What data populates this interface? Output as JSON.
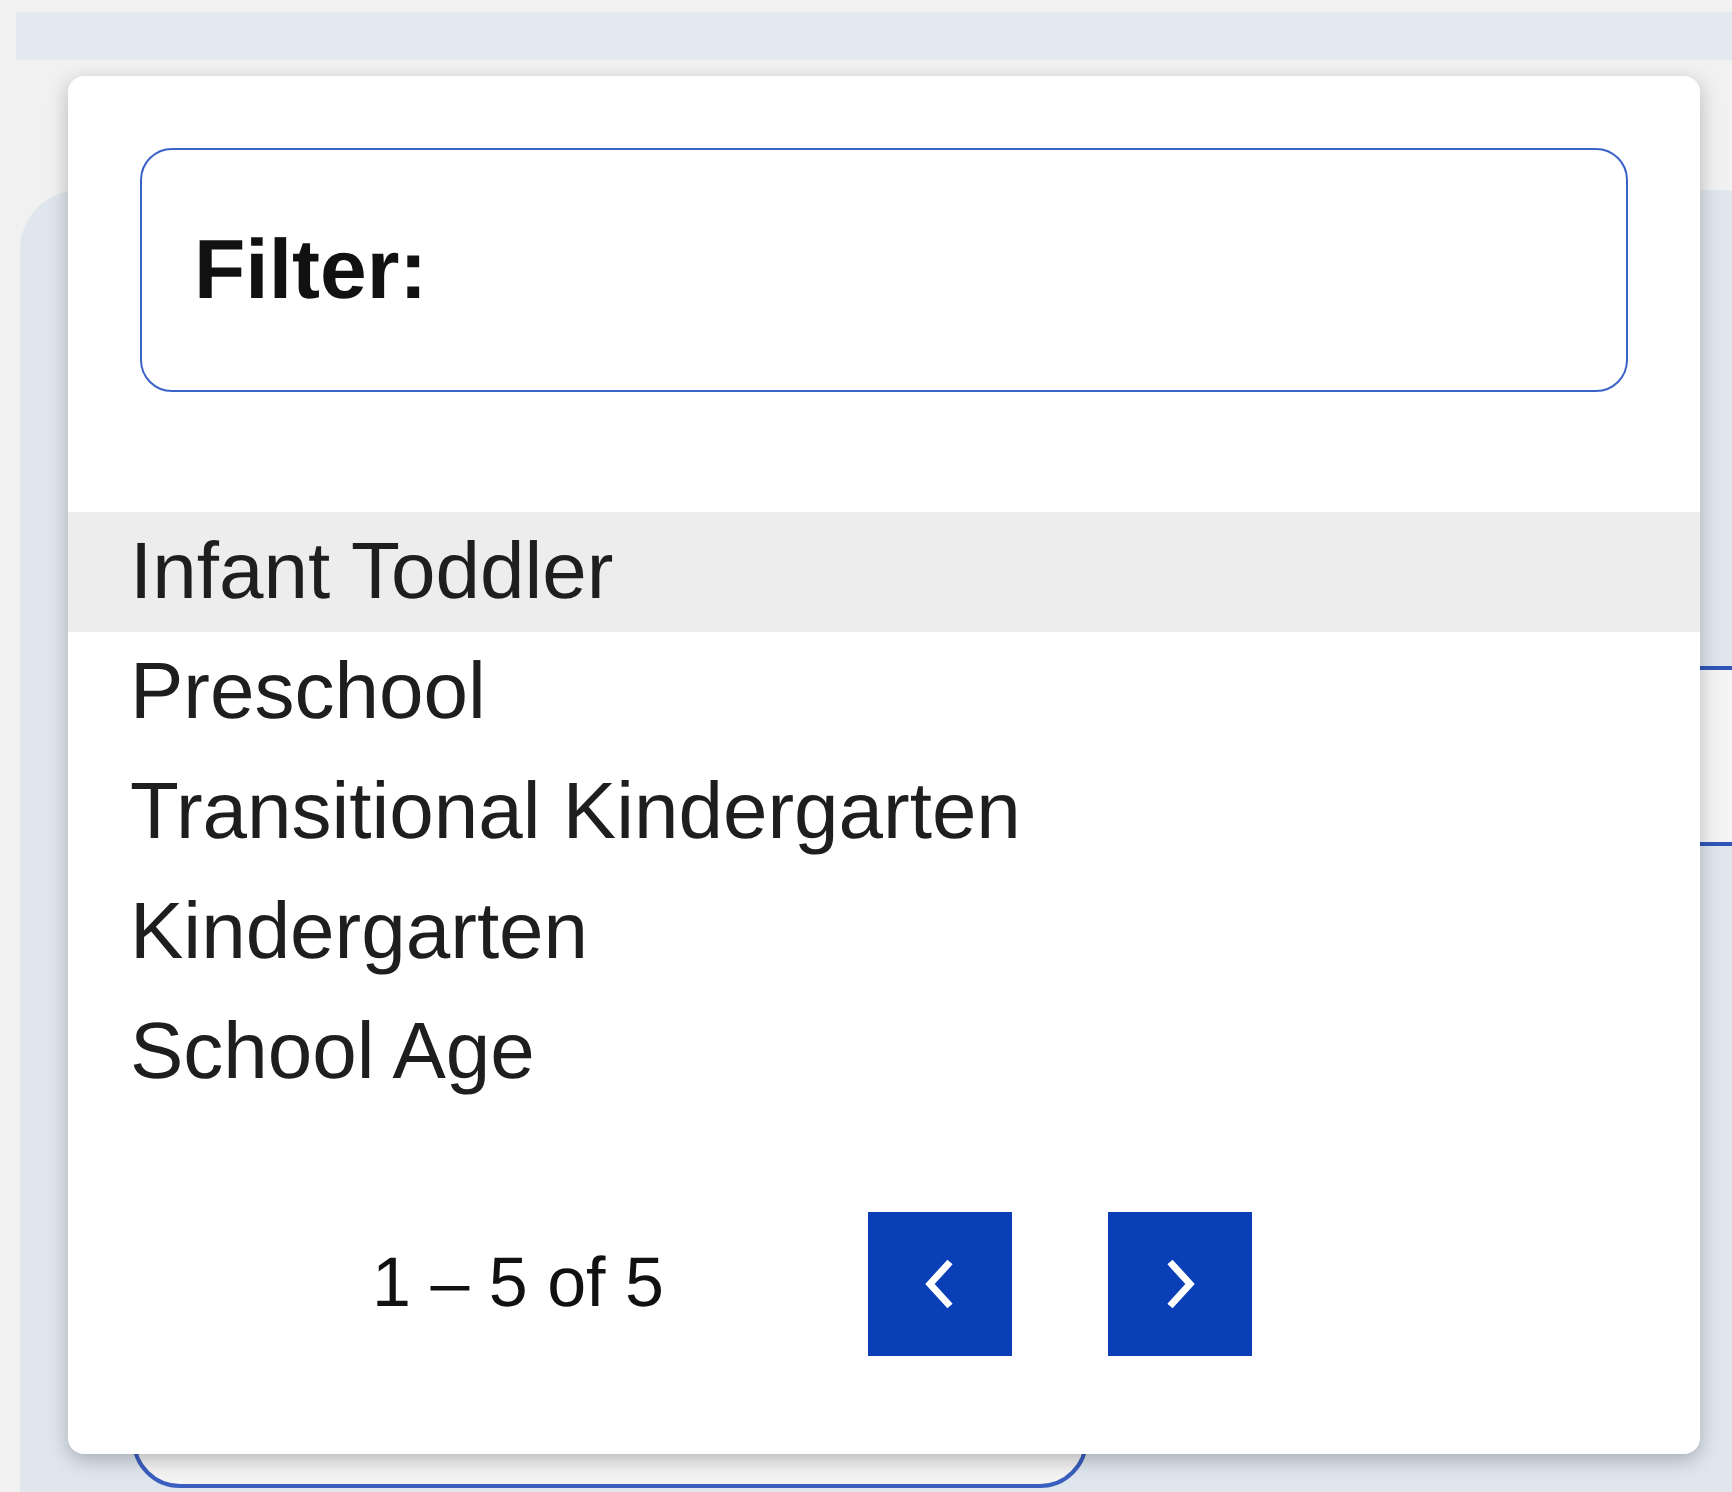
{
  "filter": {
    "label": "Filter:"
  },
  "options": [
    {
      "label": "Infant Toddler",
      "selected": true
    },
    {
      "label": "Preschool",
      "selected": false
    },
    {
      "label": "Transitional Kindergarten",
      "selected": false
    },
    {
      "label": "Kindergarten",
      "selected": false
    },
    {
      "label": "School Age",
      "selected": false
    }
  ],
  "pagination": {
    "range": "1 – 5 of 5"
  }
}
